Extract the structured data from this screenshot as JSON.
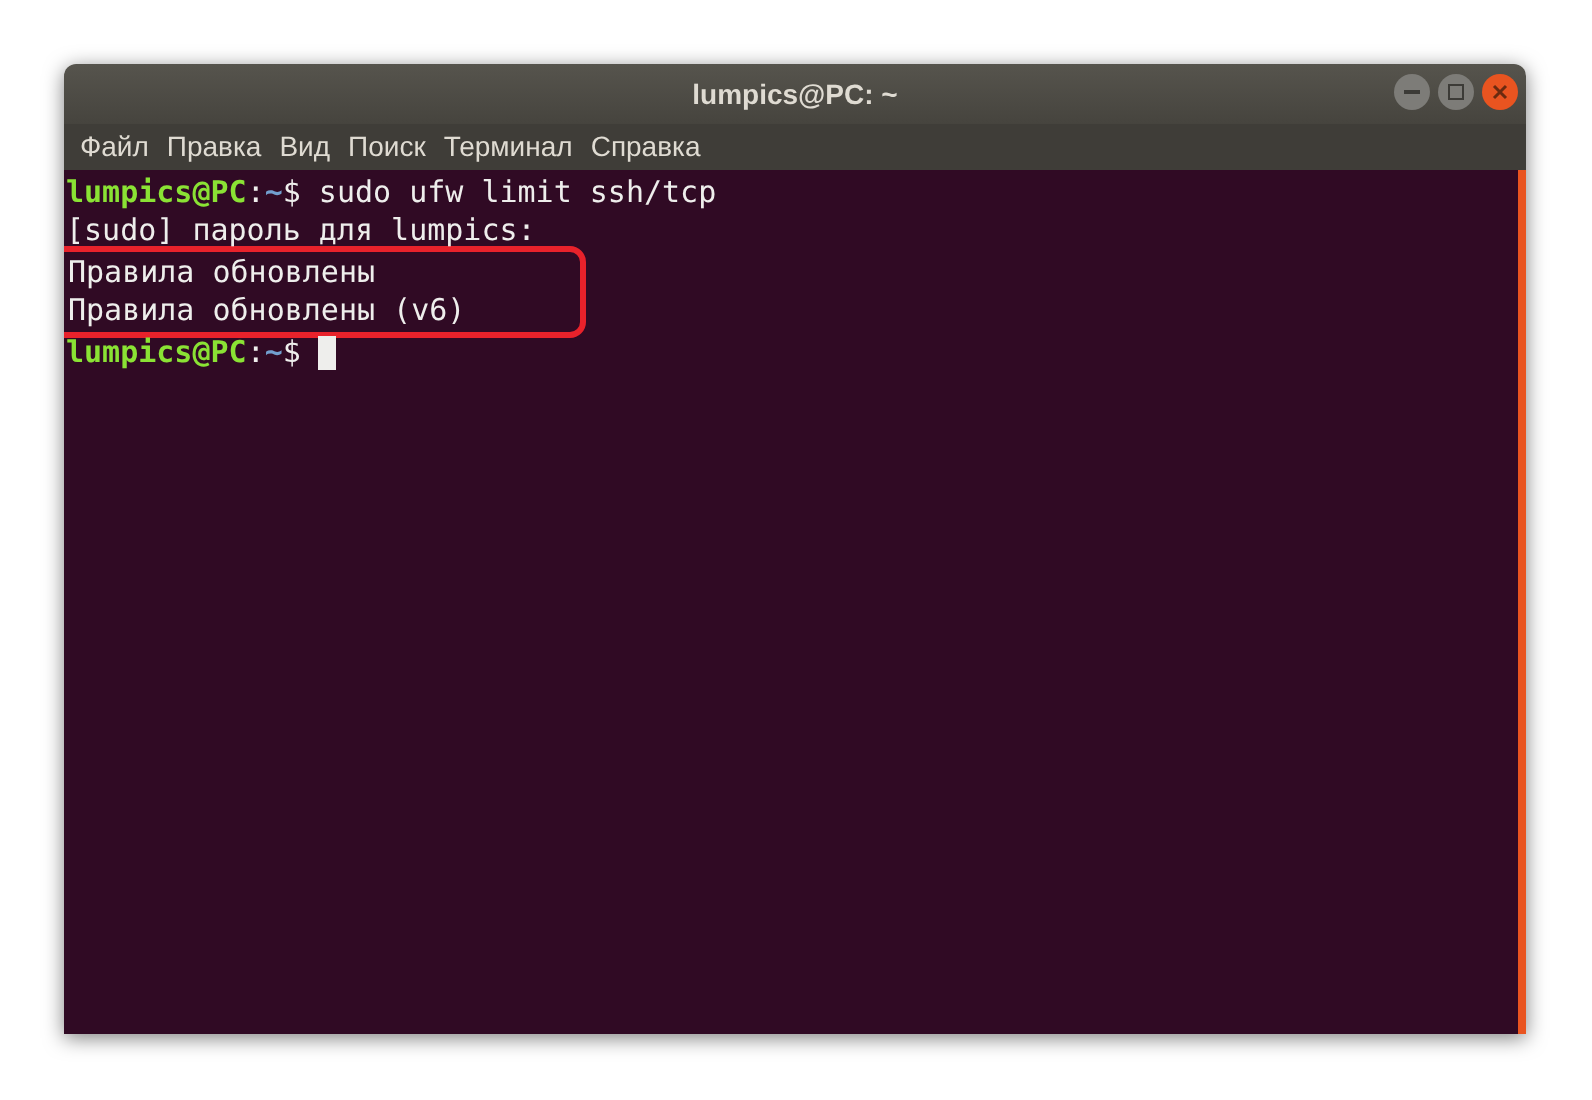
{
  "window": {
    "title": "lumpics@PC: ~"
  },
  "menu": [
    "Файл",
    "Правка",
    "Вид",
    "Поиск",
    "Терминал",
    "Справка"
  ],
  "lines": [
    {
      "highlighted": false,
      "cursor": false,
      "segments": [
        {
          "kind": "host",
          "text": "lumpics@PC"
        },
        {
          "kind": "plain",
          "text": ":"
        },
        {
          "kind": "path",
          "text": "~"
        },
        {
          "kind": "plain",
          "text": "$ sudo ufw limit ssh/tcp"
        }
      ]
    },
    {
      "highlighted": false,
      "cursor": false,
      "segments": [
        {
          "kind": "plain",
          "text": "[sudo] пароль для lumpics:"
        }
      ]
    },
    {
      "highlighted": true,
      "cursor": false,
      "segments": [
        {
          "kind": "plain",
          "text": "Правила обновлены"
        }
      ]
    },
    {
      "highlighted": true,
      "cursor": false,
      "segments": [
        {
          "kind": "plain",
          "text": "Правила обновлены (v6)"
        }
      ]
    },
    {
      "highlighted": false,
      "cursor": true,
      "segments": [
        {
          "kind": "host",
          "text": "lumpics@PC"
        },
        {
          "kind": "plain",
          "text": ":"
        },
        {
          "kind": "path",
          "text": "~"
        },
        {
          "kind": "plain",
          "text": "$ "
        }
      ]
    }
  ]
}
